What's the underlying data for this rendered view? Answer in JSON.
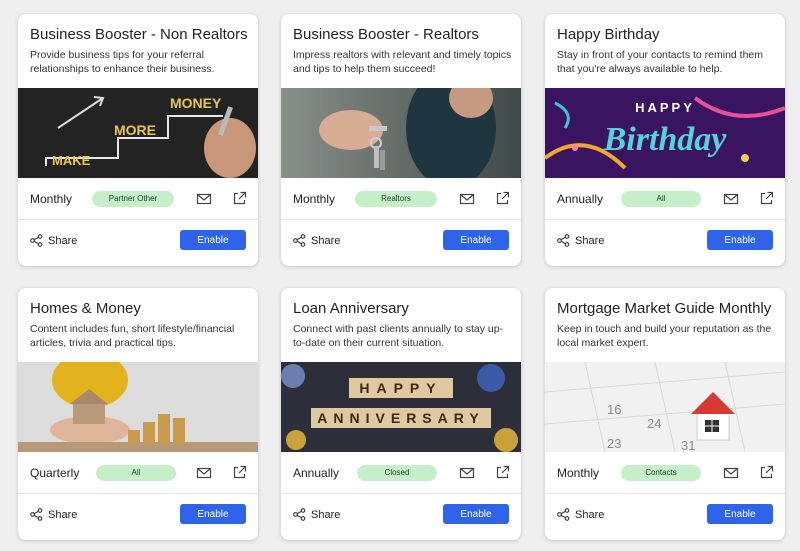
{
  "cards": [
    {
      "title": "Business Booster - Non Realtors",
      "description": "Provide business tips for your referral relationships to enhance their business.",
      "image_words": [
        "MAKE",
        "MORE",
        "MONEY"
      ],
      "frequency": "Monthly",
      "badge": "Partner Other",
      "share_label": "Share",
      "enable_label": "Enable"
    },
    {
      "title": "Business Booster - Realtors",
      "description": "Impress realtors with relevant and timely topics and tips to help them succeed!",
      "frequency": "Monthly",
      "badge": "Realtors",
      "share_label": "Share",
      "enable_label": "Enable"
    },
    {
      "title": "Happy Birthday",
      "description": "Stay in front of your contacts to remind them that you're always available to help.",
      "image_words": [
        "HAPPY",
        "Birthday"
      ],
      "frequency": "Annually",
      "badge": "All",
      "share_label": "Share",
      "enable_label": "Enable"
    },
    {
      "title": "Homes & Money",
      "description": "Content includes fun, short lifestyle/financial articles, trivia and practical tips.",
      "frequency": "Quarterly",
      "badge": "All",
      "share_label": "Share",
      "enable_label": "Enable"
    },
    {
      "title": "Loan Anniversary",
      "description": "Connect with past clients annually to stay up-to-date on their current situation.",
      "image_words": [
        "HAPPY",
        "ANNIVERSARY"
      ],
      "frequency": "Annually",
      "badge": "Closed",
      "share_label": "Share",
      "enable_label": "Enable"
    },
    {
      "title": "Mortgage Market Guide Monthly",
      "description": "Keep in touch and build your reputation as the local market expert.",
      "image_words": [
        "16",
        "23",
        "24",
        "31"
      ],
      "frequency": "Monthly",
      "badge": "Contacts",
      "share_label": "Share",
      "enable_label": "Enable"
    }
  ],
  "icons": {
    "mail": "envelope-icon",
    "external": "external-link-icon",
    "share": "share-icon"
  },
  "colors": {
    "page_background": "#efefef",
    "enable_button": "#2f64ea",
    "badge_background": "#c5efc9"
  }
}
